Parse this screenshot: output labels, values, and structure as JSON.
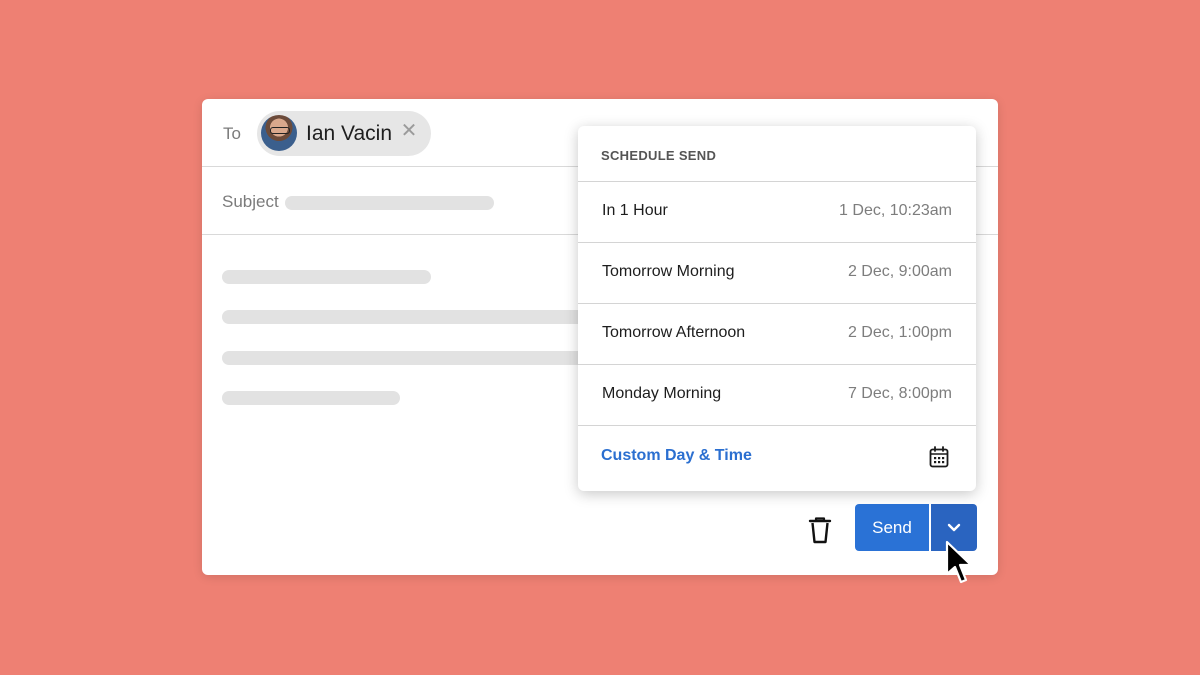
{
  "compose": {
    "to_label": "To",
    "recipient": {
      "name": "Ian Vacin",
      "remove_glyph": "✕"
    },
    "subject_label": "Subject"
  },
  "footer": {
    "send_label": "Send",
    "icons": {
      "trash": "trash-icon",
      "dropdown": "chevron-down-icon"
    }
  },
  "schedule_menu": {
    "title": "SCHEDULE SEND",
    "items": [
      {
        "label": "In 1 Hour",
        "time": "1 Dec, 10:23am"
      },
      {
        "label": "Tomorrow Morning",
        "time": "2 Dec, 9:00am"
      },
      {
        "label": "Tomorrow Afternoon",
        "time": "2 Dec, 1:00pm"
      },
      {
        "label": "Monday Morning",
        "time": "7 Dec, 8:00pm"
      }
    ],
    "custom_label": "Custom Day & Time",
    "custom_icon": "calendar-icon"
  },
  "colors": {
    "background": "#ee8073",
    "accent": "#2a72d6",
    "link": "#2b6fd0"
  }
}
